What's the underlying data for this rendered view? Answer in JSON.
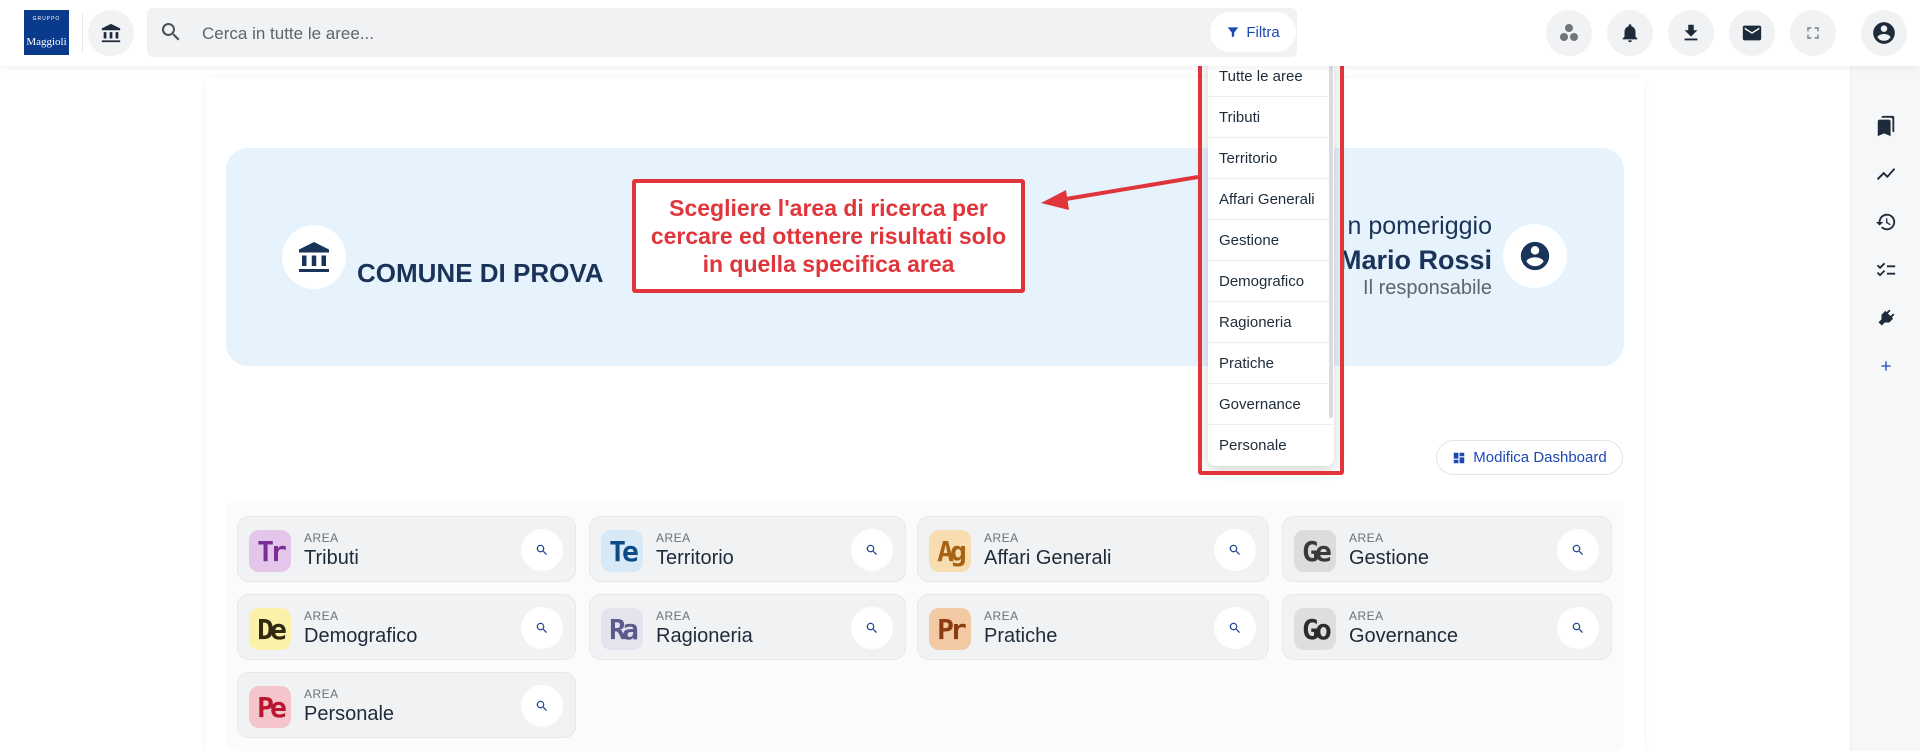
{
  "header": {
    "logo_small": "GRUPPO",
    "logo_big": "Maggioli",
    "search_placeholder": "Cerca in tutte le aree...",
    "filter_label": "Filtra"
  },
  "hero": {
    "comune": "COMUNE DI PROVA",
    "greeting": "n pomeriggio",
    "user_name": "Mario Rossi",
    "role": "Il responsabile"
  },
  "dropdown": {
    "items": [
      "Tutte le aree",
      "Tributi",
      "Territorio",
      "Affari Generali",
      "Gestione",
      "Demografico",
      "Ragioneria",
      "Pratiche",
      "Governance",
      "Personale"
    ]
  },
  "annotation": {
    "line1": "Scegliere l'area di ricerca per",
    "line2": "cercare ed ottenere risultati solo",
    "line3": "in quella specifica area"
  },
  "dashboard": {
    "edit_label": "Modifica Dashboard"
  },
  "areas": {
    "label": "AREA",
    "items": [
      {
        "abbr": "Tr",
        "name": "Tributi",
        "bg": "#e3c6ea",
        "fg": "#7b2d95"
      },
      {
        "abbr": "Te",
        "name": "Territorio",
        "bg": "#d7e9f7",
        "fg": "#0e4a86"
      },
      {
        "abbr": "Ag",
        "name": "Affari Generali",
        "bg": "#f7ddb0",
        "fg": "#a86214"
      },
      {
        "abbr": "Ge",
        "name": "Gestione",
        "bg": "#dcdcdc",
        "fg": "#3a3a3a"
      },
      {
        "abbr": "De",
        "name": "Demografico",
        "bg": "#fbf1a8",
        "fg": "#2f2a10"
      },
      {
        "abbr": "Ra",
        "name": "Ragioneria",
        "bg": "#e4e4ef",
        "fg": "#5a5b8c"
      },
      {
        "abbr": "Pr",
        "name": "Pratiche",
        "bg": "#f3c9a4",
        "fg": "#8a3b12"
      },
      {
        "abbr": "Go",
        "name": "Governance",
        "bg": "#dedede",
        "fg": "#2c2c2c"
      },
      {
        "abbr": "Pe",
        "name": "Personale",
        "bg": "#f6c5cc",
        "fg": "#b8152f"
      }
    ]
  },
  "colors": {
    "accent": "#1c48b5",
    "annotation_red": "#e0353b",
    "hero_bg": "#e6f2fc",
    "navy": "#1a3358"
  }
}
